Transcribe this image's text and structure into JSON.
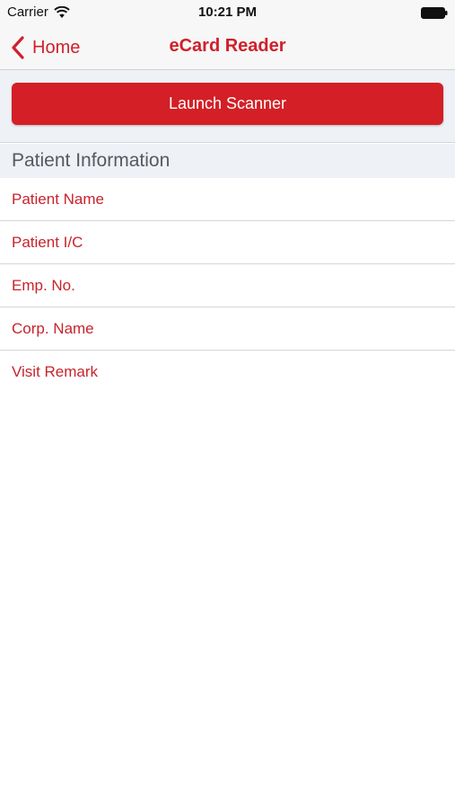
{
  "status_bar": {
    "carrier": "Carrier",
    "time": "10:21 PM",
    "icons": [
      "wifi-icon",
      "battery-icon"
    ]
  },
  "nav": {
    "back_label": "Home",
    "title": "eCard Reader"
  },
  "scanner": {
    "button_label": "Launch Scanner"
  },
  "section": {
    "title": "Patient Information"
  },
  "fields": [
    {
      "label": "Patient Name"
    },
    {
      "label": "Patient I/C"
    },
    {
      "label": "Emp. No."
    },
    {
      "label": "Corp. Name"
    },
    {
      "label": "Visit Remark"
    }
  ],
  "colors": {
    "accent": "#d0202a",
    "button": "#d41f26",
    "section_bg": "#eef1f5"
  }
}
